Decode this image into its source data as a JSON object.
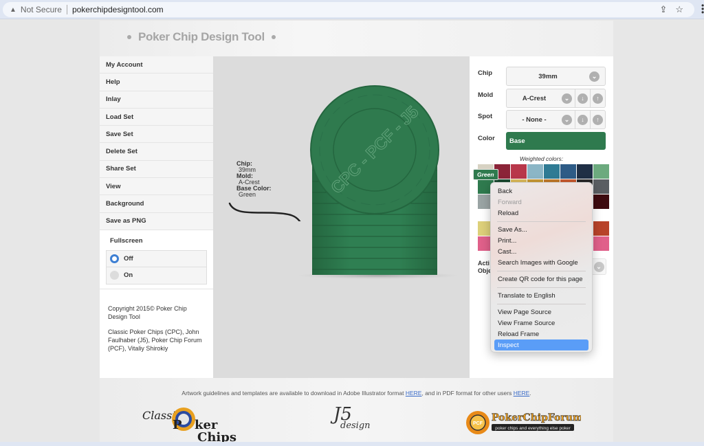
{
  "browser": {
    "security_label": "Not Secure",
    "url": "pokerchipdesigntool.com"
  },
  "header": {
    "title": "Poker Chip Design Tool"
  },
  "sidebar": {
    "items": [
      {
        "label": "My Account"
      },
      {
        "label": "Help"
      },
      {
        "label": "Inlay"
      },
      {
        "label": "Load Set"
      },
      {
        "label": "Save Set"
      },
      {
        "label": "Delete Set"
      },
      {
        "label": "Share Set"
      },
      {
        "label": "View"
      },
      {
        "label": "Background"
      },
      {
        "label": "Save as PNG"
      }
    ],
    "fullscreen": {
      "label": "Fullscreen",
      "options": [
        {
          "label": "Off",
          "selected": true
        },
        {
          "label": "On",
          "selected": false
        }
      ]
    },
    "credits": [
      "Copyright 2015© Poker Chip Design Tool",
      "Classic Poker Chips (CPC), John Faulhaber (J5), Poker Chip Forum (PCF), Vitaliy Shirokiy"
    ]
  },
  "canvas": {
    "info": {
      "chip_label": "Chip:",
      "chip_value": "39mm",
      "mold_label": "Mold:",
      "mold_value": "A-Crest",
      "base_label": "Base Color:",
      "base_value": "Green"
    },
    "watermark": "CPC - PCF - J5",
    "chip_color": "#2f7a4e"
  },
  "panel": {
    "chip": {
      "label": "Chip",
      "value": "39mm"
    },
    "mold": {
      "label": "Mold",
      "value": "A-Crest"
    },
    "spot": {
      "label": "Spot",
      "value": "- None -"
    },
    "color": {
      "label": "Color",
      "value": "Base"
    },
    "weighted_label": "Weighted colors:",
    "selected_color_name": "Green",
    "swatches_row1": [
      "#d7d2c3",
      "#8b2438",
      "#b8374a",
      "#8bb6c6",
      "#2f7b94",
      "#2d5b86",
      "#1f2f45",
      "#6caa7e"
    ],
    "swatches_row2": [
      "#2f7a4e",
      "#1c4a30",
      "#dcbb5b",
      "#c89a36",
      "#c07a2a",
      "#c85a30",
      "#2a2a2a",
      "#5a5e62"
    ],
    "swatches_row3": [
      "#9aa4a4",
      "#9aa4a4",
      "#9aa4a4",
      "#9aa4a4",
      "#9aa4a4",
      "#9aa4a4",
      "#4a1a1a",
      "#3e0b10"
    ],
    "swatches_row4": [
      "#ddd07a",
      "#ddd07a",
      "#ddd07a",
      "#ddd07a",
      "#ddd07a",
      "#ddd07a",
      "#ddd07a",
      "#b8432a"
    ],
    "swatches_row5": [
      "#e0608a",
      "#e0608a",
      "#e0608a",
      "#e0608a",
      "#e0608a",
      "#e0608a",
      "#e0608a",
      "#e0608a"
    ],
    "active_label_1": "Acti",
    "active_label_2": "Obje"
  },
  "footer": {
    "note_prefix": "Artwork guidelines and templates are available to download in Adobe Illustrator format ",
    "link1": "HERE",
    "note_middle": ", and in PDF format for other users ",
    "link2": "HERE",
    "note_suffix": ".",
    "logo_cpc_1": "Classic",
    "logo_cpc_2": "ker",
    "logo_cpc_3": "Chips",
    "logo_j5": "J5",
    "logo_j5_sub": "design",
    "logo_pcf": "PokerChipForum",
    "logo_pcf_sub": "poker chips and everything else poker"
  },
  "context_menu": {
    "groups": [
      [
        {
          "label": "Back"
        },
        {
          "label": "Forward",
          "disabled": true
        },
        {
          "label": "Reload"
        }
      ],
      [
        {
          "label": "Save As..."
        },
        {
          "label": "Print..."
        },
        {
          "label": "Cast..."
        },
        {
          "label": "Search Images with Google"
        }
      ],
      [
        {
          "label": "Create QR code for this page"
        }
      ],
      [
        {
          "label": "Translate to English"
        }
      ],
      [
        {
          "label": "View Page Source"
        },
        {
          "label": "View Frame Source"
        },
        {
          "label": "Reload Frame"
        },
        {
          "label": "Inspect",
          "highlighted": true
        }
      ]
    ]
  }
}
